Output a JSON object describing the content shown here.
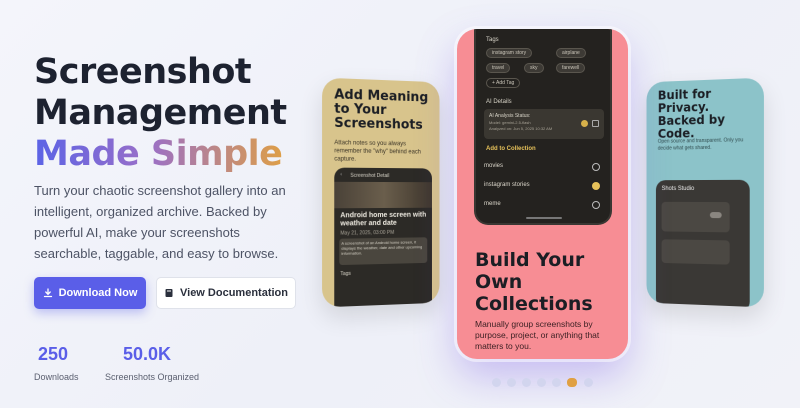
{
  "hero": {
    "title_line1": "Screenshot",
    "title_line2": "Management",
    "title_line3": "Made Simple",
    "description": "Turn your chaotic screenshot gallery into an intelligent, organized archive. Backed by powerful AI, make your screenshots searchable, taggable, and easy to browse."
  },
  "buttons": {
    "download_label": "Download Now",
    "docs_label": "View Documentation"
  },
  "stats": [
    {
      "value": "250",
      "label": "Downloads"
    },
    {
      "value": "50.0K",
      "label": "Screenshots Organized"
    }
  ],
  "cards": {
    "left": {
      "title": "Add Meaning to Your Screenshots",
      "subtitle": "Attach notes so you always remember the \"why\" behind each capture.",
      "screen_title": "Screenshot Detail",
      "screen_heading": "Android home screen with weather and date",
      "screen_meta": "May 21, 2025, 03:00 PM",
      "screen_note": "A screenshot of an Android home screen, it displays the weather, date and other upcoming information.",
      "tags_label": "Tags"
    },
    "center": {
      "tags_label": "Tags",
      "tags": [
        "instagram story",
        "airplane",
        "travel",
        "sky",
        "farewell"
      ],
      "add_tag": "+ Add Tag",
      "ai_details_label": "AI Details",
      "ai_status_title": "AI Analysis Status:",
      "ai_status_model": "Model: gemini-2.5-flash",
      "ai_status_date": "Analyzed on: Jun 5, 2025 10:32 AM",
      "add_to_collection_label": "Add to Collection",
      "collections": [
        "movies",
        "instagram stories",
        "meme"
      ],
      "title": "Build Your Own Collections",
      "subtitle": "Manually group screenshots by purpose, project, or anything that matters to you."
    },
    "right": {
      "title": "Built for Privacy. Backed by Code.",
      "subtitle": "Open source and transparent. Only you decide what gets shared.",
      "screen_title": "Shots Studio"
    }
  },
  "colors": {
    "accent": "#5a5ee8",
    "gradient_end": "#e0a043",
    "card_left": "#d8c48c",
    "card_center": "#f78d94",
    "card_right": "#8cc3c9"
  },
  "carousel": {
    "total": 7,
    "active": 5
  }
}
